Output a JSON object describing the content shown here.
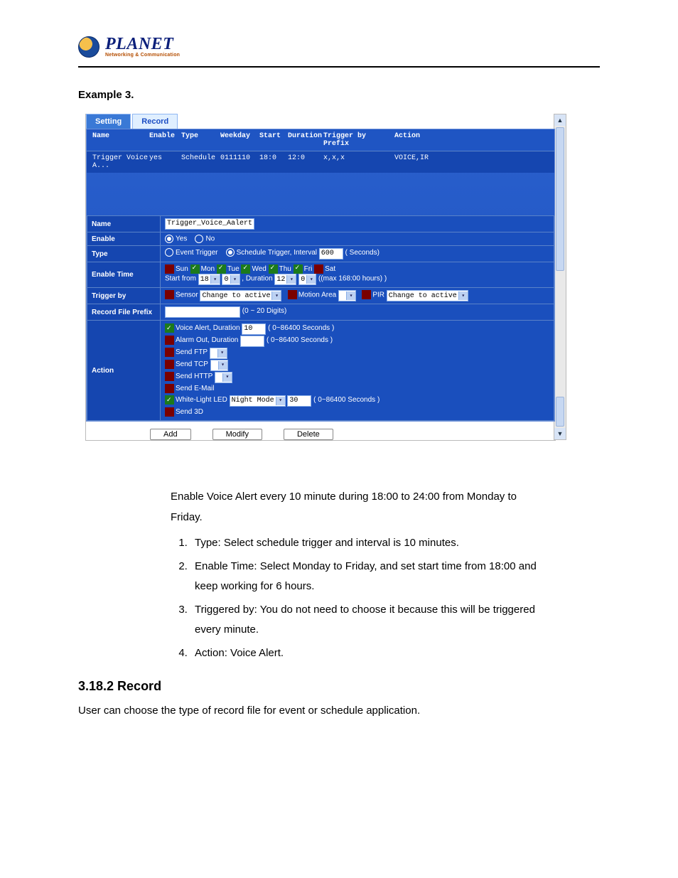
{
  "brand": {
    "name": "PLANET",
    "tagline": "Networking & Communication"
  },
  "example_title": "Example 3.",
  "tabs": {
    "setting": "Setting",
    "record": "Record"
  },
  "columns": {
    "name": "Name",
    "enable": "Enable",
    "type": "Type",
    "weekday": "Weekday",
    "start": "Start",
    "duration": "Duration",
    "trigger_by_prefix": "Trigger by Prefix",
    "action": "Action"
  },
  "row1": {
    "name": "Trigger Voice A...",
    "enable": "yes",
    "type": "Schedule",
    "weekday": "0111110",
    "start": "18:0",
    "duration": "12:0",
    "trigger": "x,x,x",
    "action": "VOICE,IR"
  },
  "form": {
    "name_label": "Name",
    "name_value": "Trigger_Voice_Aalert",
    "enable_label": "Enable",
    "yes": "Yes",
    "no": "No",
    "type_label": "Type",
    "event_trigger": "Event Trigger",
    "schedule_trigger": "Schedule Trigger, Interval",
    "schedule_interval": "600",
    "seconds": "( Seconds)",
    "enable_time_label": "Enable Time",
    "days": {
      "sun": "Sun",
      "mon": "Mon",
      "tue": "Tue",
      "wed": "Wed",
      "thu": "Thu",
      "fri": "Fri",
      "sat": "Sat"
    },
    "start_from": "Start from",
    "start_h": "18",
    "start_m": "0",
    "duration_label": ", Duration",
    "dur_h": "12",
    "dur_m": "0",
    "max_hours": "((max 168:00 hours) )",
    "trigger_by_label": "Trigger by",
    "sensor": "Sensor",
    "sensor_opt": "Change to active",
    "motion": "Motion Area",
    "pir": "PIR",
    "pir_opt": "Change to active",
    "prefix_label": "Record File Prefix",
    "prefix_note": "(0 ~ 20 Digits)",
    "action_label": "Action",
    "voice_alert": "Voice Alert, Duration",
    "va_val": "10",
    "va_range": "( 0~86400 Seconds )",
    "alarm_out": "Alarm Out, Duration",
    "ao_range": "( 0~86400 Seconds )",
    "send_ftp": "Send FTP",
    "send_tcp": "Send TCP",
    "send_http": "Send HTTP",
    "send_email": "Send E-Mail",
    "white_led": "White-Light LED",
    "wl_mode": "Night Mode",
    "wl_val": "30",
    "wl_range": "( 0~86400 Seconds )",
    "send_3d": "Send 3D"
  },
  "buttons": {
    "add": "Add",
    "modify": "Modify",
    "delete": "Delete"
  },
  "scroll": {
    "up_glyph": "▲",
    "down_glyph": "▼"
  },
  "description": {
    "intro": "Enable Voice Alert every 10 minute during 18:00 to 24:00 from Monday to Friday.",
    "s1": "Type: Select schedule trigger and interval is 10 minutes.",
    "s2": "Enable Time: Select Monday to Friday, and set start time from 18:00 and keep working for 6 hours.",
    "s3": "Triggered by: You do not need to choose it because this will be triggered every minute.",
    "s4": "Action: Voice Alert."
  },
  "section": {
    "heading": "3.18.2 Record",
    "text": "User can choose the type of record file for event or schedule application."
  }
}
